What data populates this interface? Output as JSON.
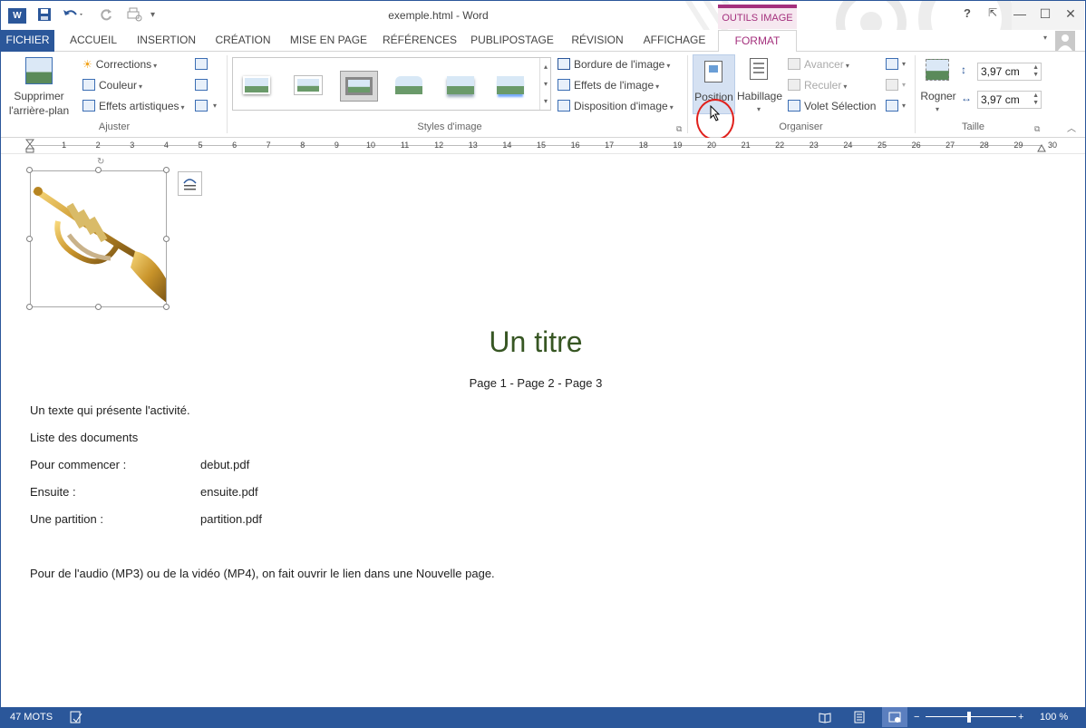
{
  "titlebar": {
    "doc_title": "exemple.html - Word",
    "context_tab_group": "OUTILS IMAGE",
    "help": "?",
    "minimize": "—",
    "maximize": "☐",
    "close": "✕",
    "restore_ribbon": "⇱"
  },
  "tabs": [
    "FICHIER",
    "ACCUEIL",
    "INSERTION",
    "CRÉATION",
    "MISE EN PAGE",
    "RÉFÉRENCES",
    "PUBLIPOSTAGE",
    "RÉVISION",
    "AFFICHAGE",
    "FORMAT"
  ],
  "ribbon": {
    "ajuster": {
      "label": "Ajuster",
      "remove_bg_line1": "Supprimer",
      "remove_bg_line2": "l'arrière-plan",
      "corrections": "Corrections",
      "couleur": "Couleur",
      "effets_artistiques": "Effets artistiques"
    },
    "styles": {
      "label": "Styles d'image",
      "bordure": "Bordure de l'image",
      "effets": "Effets de l'image",
      "disposition": "Disposition d'image"
    },
    "organiser": {
      "label": "Organiser",
      "position": "Position",
      "habillage": "Habillage",
      "avancer": "Avancer",
      "reculer": "Reculer",
      "volet": "Volet Sélection"
    },
    "taille": {
      "label": "Taille",
      "rogner": "Rogner",
      "height": "3,97 cm",
      "width": "3,97 cm"
    }
  },
  "ruler": {
    "ticks": [
      "1",
      "2",
      "3",
      "4",
      "5",
      "6",
      "7",
      "8",
      "9",
      "10",
      "11",
      "12",
      "13",
      "14",
      "15",
      "16",
      "17",
      "18",
      "19",
      "20",
      "21",
      "22",
      "23",
      "24",
      "25",
      "26",
      "27",
      "28",
      "29",
      "30"
    ]
  },
  "document": {
    "title": "Un titre",
    "pages_nav": "Page 1  -  Page 2 -  Page 3",
    "intro": "Un texte qui présente l'activité.",
    "list_heading": "Liste des documents",
    "rows": [
      {
        "label": "Pour commencer :",
        "file": "debut.pdf"
      },
      {
        "label": "Ensuite :",
        "file": "ensuite.pdf"
      },
      {
        "label": "Une partition :",
        "file": "partition.pdf"
      }
    ],
    "footer_note": "Pour de l'audio (MP3) ou de la vidéo (MP4), on fait ouvrir le lien dans une Nouvelle page."
  },
  "status": {
    "word_count": "47 MOTS",
    "zoom": "100 %",
    "zoom_minus": "−",
    "zoom_plus": "+"
  },
  "colors": {
    "word_blue": "#2b579a",
    "format_accent": "#a4307d",
    "title_green": "#375623",
    "callout_red": "#e0201c"
  }
}
